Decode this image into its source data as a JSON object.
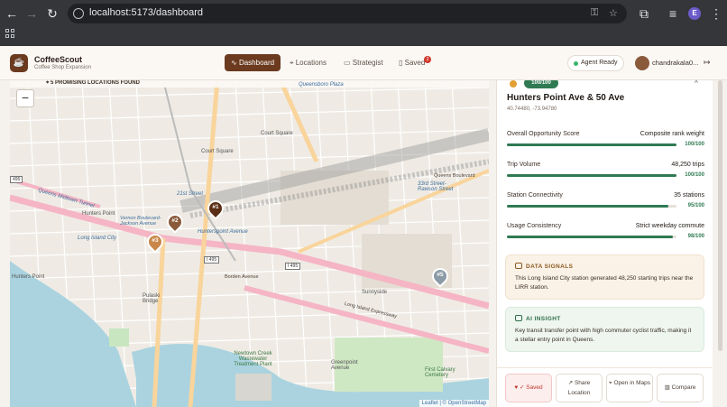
{
  "browser": {
    "url": "localhost:5173/dashboard",
    "profile_initial": "E",
    "icons": [
      "back-icon",
      "forward-icon",
      "reload-icon",
      "site-info-icon",
      "password-key-icon",
      "bookmark-star-icon",
      "extensions-icon",
      "media-icon",
      "menu-icon",
      "apps-grid-icon"
    ]
  },
  "header": {
    "brand": "CoffeeScout",
    "tagline": "Coffee Shop Expansion",
    "nav": {
      "dashboard": "Dashboard",
      "locations": "Locations",
      "strategist": "Strategist",
      "saved": "Saved"
    },
    "saved_count": "2",
    "agent_status": "Agent Ready",
    "username": "chandrakala0...",
    "accent": "#6b3a1f",
    "status_color": "#39b36a"
  },
  "map": {
    "found_banner": "5 PROMISING LOCATIONS FOUND",
    "zoom_out": "−",
    "attribution": "Leaflet | © OpenStreetMap",
    "labels": {
      "queensboro_plaza": "Queensboro Plaza",
      "court_square": "Court Square",
      "court_square_2": "Court Square",
      "twenty_first_street": "21st Street",
      "hunters_point": "Hunters Point",
      "hunterspoint_avenue": "Hunterspoint Avenue",
      "vernon_jackson": "Vernon Boulevard-Jackson Avenue",
      "long_island_city": "Long Island City",
      "thirty_third_street": "33rd Street-Rawson Street",
      "queens_boulevard": "Queens Boulevard",
      "borden_avenue": "Borden Avenue",
      "pulaski_bridge": "Pulaski Bridge",
      "sunnyside": "Sunnyside",
      "lie_expressway": "Long Island Expressway",
      "newtown_creek": "Newtown Creek Wastewater Treatment Plant",
      "greenpoint": "Greenpoint Avenue",
      "first_calvary": "First Calvary Cemetery",
      "queens_midtown": "Queens Midtown Tunnel",
      "hunters": "Hunters Point",
      "i495_a": "I 495",
      "i495_b": "I 495",
      "i495_c": "495"
    },
    "pins": [
      {
        "label": "#1",
        "color": "#5a2d14"
      },
      {
        "label": "#2",
        "color": "#8a5a3b"
      },
      {
        "label": "#3",
        "color": "#c9884a"
      },
      {
        "label": "#5",
        "color": "#8c9aa6"
      }
    ]
  },
  "panel": {
    "rank": "100/100",
    "title": "Hunters Point Ave & 50 Ave",
    "coords": "40.74480, -73.94780",
    "metrics": [
      {
        "label": "Overall Opportunity Score",
        "value": "Composite rank weight",
        "score": "100/100",
        "fill": 1.0
      },
      {
        "label": "Trip Volume",
        "value": "48,250 trips",
        "score": "100/100",
        "fill": 1.0
      },
      {
        "label": "Station Connectivity",
        "value": "35 stations",
        "score": "95/100",
        "fill": 0.95
      },
      {
        "label": "Usage Consistency",
        "value": "Strict weekday commute",
        "score": "98/100",
        "fill": 0.98
      }
    ],
    "signals_title": "DATA SIGNALS",
    "signals_body": "This Long Island City station generated 48,250 starting trips near the LIRR station.",
    "insight_title": "AI INSIGHT",
    "insight_body": "Key transit transfer point with high commuter cyclist traffic, making it a stellar entry point in Queens.",
    "actions": {
      "saved": "✓ Saved",
      "share": "Share Location",
      "maps": "Open in Maps",
      "compare": "Compare"
    },
    "success_color": "#2f7a52"
  }
}
